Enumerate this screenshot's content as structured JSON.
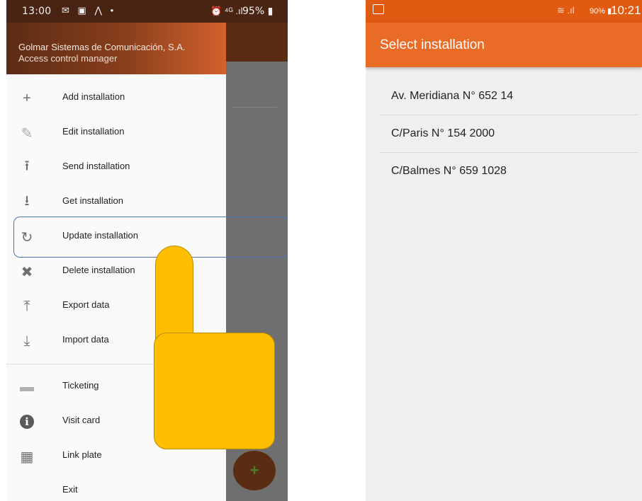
{
  "left_phone": {
    "status_bar": {
      "time": "13:00",
      "left_icons": "✉ ▣ ⋀ •",
      "right_icons": "⏰ ⁴ᴳ .ıl",
      "battery": "95% ▮"
    },
    "drawer": {
      "company": "Golmar Sistemas de Comunicación, S.A.",
      "subtitle": "Access control manager",
      "items": [
        {
          "label": "Add installation",
          "icon": "plus-icon",
          "glyph": "+"
        },
        {
          "label": "Edit installation",
          "icon": "pencil-icon",
          "glyph": "✎"
        },
        {
          "label": "Send installation",
          "icon": "upload-icon",
          "glyph": "⭱"
        },
        {
          "label": "Get installation",
          "icon": "download-icon",
          "glyph": "⭳"
        },
        {
          "label": "Update installation",
          "icon": "refresh-icon",
          "glyph": "↻"
        },
        {
          "label": "Delete installation",
          "icon": "close-icon",
          "glyph": "✖"
        },
        {
          "label": "Export data",
          "icon": "export-icon",
          "glyph": "⤒"
        },
        {
          "label": "Import data",
          "icon": "import-icon",
          "glyph": "⤓"
        },
        {
          "label": "Ticketing",
          "icon": "ticket-icon",
          "glyph": "▬"
        },
        {
          "label": "Visit card",
          "icon": "info-icon",
          "glyph": "ℹ"
        },
        {
          "label": "Link plate",
          "icon": "keypad-icon",
          "glyph": "▦"
        },
        {
          "label": "Exit",
          "icon": "",
          "glyph": ""
        }
      ]
    },
    "fab_icon": "+",
    "highlighted_item": "Update installation"
  },
  "right_phone": {
    "status_bar": {
      "right_icons": "≋ .ıl",
      "battery": "90% ▮",
      "time": "10:21"
    },
    "toolbar_title": "Select installation",
    "installations": [
      "Av. Meridiana N° 652 14",
      "C/Paris N° 154 2000",
      "C/Balmes N° 659 1028"
    ]
  },
  "colors": {
    "accent_orange": "#ea6b25",
    "status_orange": "#e05a12",
    "drawer_header_dark": "#5b2c14",
    "highlight_outline": "#4a77b0",
    "pointer_hand": "#ffbf00"
  }
}
